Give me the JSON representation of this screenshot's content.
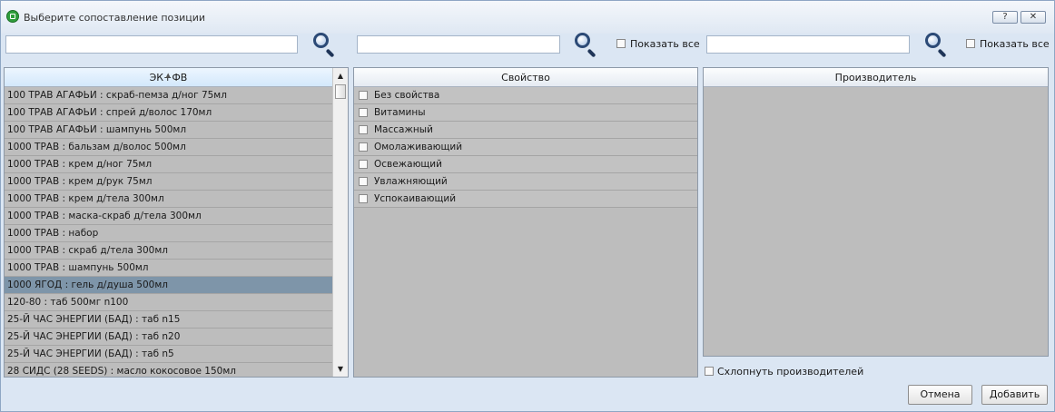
{
  "window": {
    "title": "Выберите сопоставление позиции",
    "help_label": "?",
    "close_label": "✕"
  },
  "search": {
    "query1": "",
    "query2": "",
    "query3": ""
  },
  "show_all": {
    "label2": "Показать все",
    "label3": "Показать все"
  },
  "products": {
    "header": "ЭК+ФВ",
    "items": [
      "100 ТРАВ АГАФЬИ : скраб-пемза д/ног 75мл",
      "100 ТРАВ АГАФЬИ : спрей д/волос 170мл",
      "100 ТРАВ АГАФЬИ : шампунь 500мл",
      "1000 ТРАВ : бальзам д/волос 500мл",
      "1000 ТРАВ : крем д/ног 75мл",
      "1000 ТРАВ : крем д/рук 75мл",
      "1000 ТРАВ : крем д/тела 300мл",
      "1000 ТРАВ : маска-скраб д/тела 300мл",
      "1000 ТРАВ : набор",
      "1000 ТРАВ : скраб д/тела 300мл",
      "1000 ТРАВ : шампунь 500мл",
      "1000 ЯГОД : гель д/душа 500мл",
      "120-80 : таб 500мг n100",
      "25-Й ЧАС ЭНЕРГИИ (БАД) : таб n15",
      "25-Й ЧАС ЭНЕРГИИ (БАД) : таб n20",
      "25-Й ЧАС ЭНЕРГИИ (БАД) : таб n5",
      "28 СИДС (28 SEEDS) : масло кокосовое 150мл"
    ],
    "selected_item": "1000 ЯГОД : гель д/душа 500мл"
  },
  "properties": {
    "header": "Свойство",
    "items": [
      "Без свойства",
      "Витамины",
      "Массажный",
      "Омолаживающий",
      "Освежающий",
      "Увлажняющий",
      "Успокаивающий"
    ]
  },
  "manufacturers": {
    "header": "Производитель",
    "items": []
  },
  "collapse_label": "Схлопнуть производителей",
  "buttons": {
    "cancel": "Отмена",
    "add": "Добавить"
  }
}
